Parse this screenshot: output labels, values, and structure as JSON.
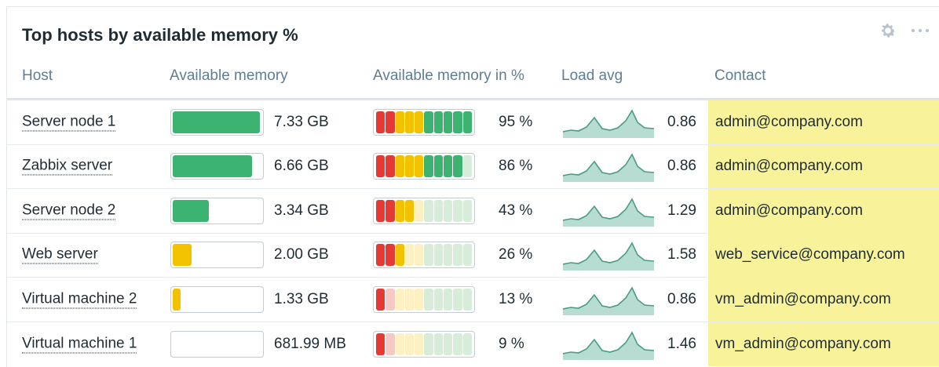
{
  "widget": {
    "title": "Top hosts by available memory %",
    "gear_icon": "gear-icon",
    "menu_icon": "more-icon"
  },
  "columns": {
    "host": "Host",
    "available_memory": "Available memory",
    "available_memory_pct": "Available memory in %",
    "load_avg": "Load avg",
    "contact": "Contact"
  },
  "colors": {
    "green": "#3cb371",
    "yellow": "#f2c200",
    "red": "#e53935",
    "sparkline": "#4a9b86",
    "sparkline_fill": "#b7dcd2",
    "contact_highlight": "#f8f29b"
  },
  "rows": [
    {
      "host": "Server node 1",
      "memory": "7.33 GB",
      "memory_fraction": 0.98,
      "percent": "95 %",
      "percent_value": 95,
      "load": "0.86",
      "contact": "admin@company.com"
    },
    {
      "host": "Zabbix server",
      "memory": "6.66 GB",
      "memory_fraction": 0.89,
      "percent": "86 %",
      "percent_value": 86,
      "load": "0.86",
      "contact": "admin@company.com"
    },
    {
      "host": "Server node 2",
      "memory": "3.34 GB",
      "memory_fraction": 0.41,
      "percent": "43 %",
      "percent_value": 43,
      "load": "1.29",
      "contact": "admin@company.com"
    },
    {
      "host": "Web server",
      "memory": "2.00 GB",
      "memory_fraction": 0.21,
      "percent": "26 %",
      "percent_value": 26,
      "load": "1.58",
      "contact": "web_service@company.com"
    },
    {
      "host": "Virtual machine 2",
      "memory": "1.33 GB",
      "memory_fraction": 0.09,
      "percent": "13 %",
      "percent_value": 13,
      "load": "0.86",
      "contact": "vm_admin@company.com"
    },
    {
      "host": "Virtual machine 1",
      "memory": "681.99 MB",
      "memory_fraction": 0.0,
      "percent": "9 %",
      "percent_value": 9,
      "load": "1.46",
      "contact": "vm_admin@company.com"
    }
  ]
}
